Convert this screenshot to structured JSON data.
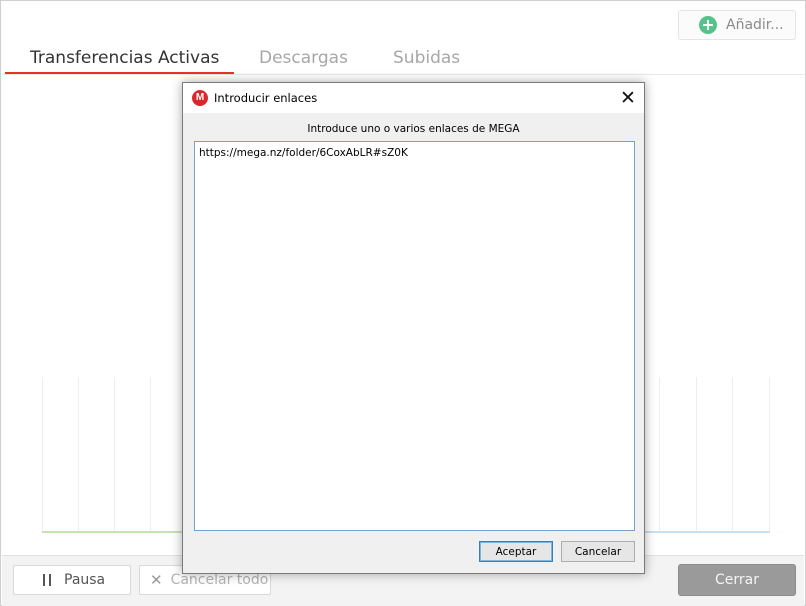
{
  "header": {
    "add_button_label": "Añadir...",
    "add_icon": "plus-circle-icon"
  },
  "tabs": [
    {
      "label": "Transferencias Activas",
      "active": true
    },
    {
      "label": "Descargas",
      "active": false
    },
    {
      "label": "Subidas",
      "active": false
    }
  ],
  "footer": {
    "pause_label": "Pausa",
    "cancel_all_label": "Cancelar todo",
    "close_label": "Cerrar"
  },
  "dialog": {
    "title": "Introducir enlaces",
    "prompt": "Introduce uno o varios enlaces de MEGA",
    "links_value": "https://mega.nz/folder/6CoxAbLR#sZ0K",
    "ok_label": "Aceptar",
    "cancel_label": "Cancelar",
    "app_icon_letter": "M"
  },
  "colors": {
    "accent_red": "#e6332a",
    "mega_red": "#d9272e",
    "add_green": "#54c389",
    "download_line": "#c6e3b4",
    "upload_line": "#c9e1ee"
  }
}
